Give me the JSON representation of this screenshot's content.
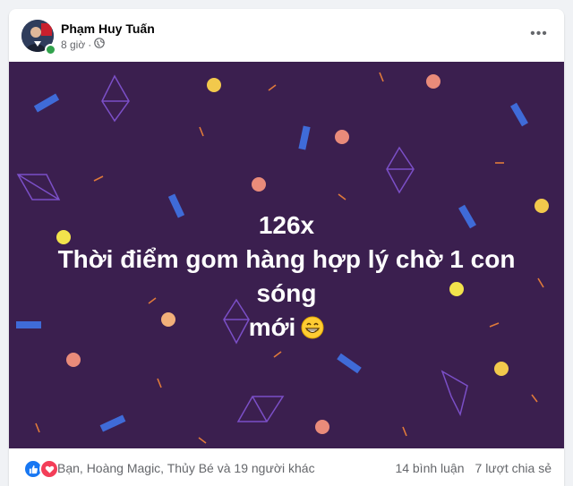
{
  "post": {
    "author": "Phạm Huy Tuấn",
    "time": "8 giờ",
    "privacy_icon": "public-globe-icon",
    "more_icon": "more-options-icon",
    "text_line1": "126x",
    "text_line2": "Thời điểm gom hàng hợp lý chờ 1 con sóng",
    "text_line3": "mới",
    "emoji": "grinning-face-icon",
    "background_color": "#3b1f4f"
  },
  "footer": {
    "reactions_text": "Bạn, Hoàng Magic, Thủy Bé và 19 người khác",
    "comments": "14 bình luận",
    "shares": "7 lượt chia sẻ",
    "like_color": "#1877f2",
    "love_color": "#f33e58"
  }
}
